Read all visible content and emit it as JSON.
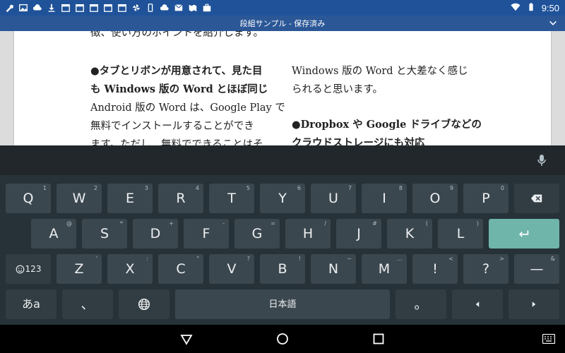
{
  "status_bar": {
    "time": "9:50",
    "icons": [
      "wrench-icon",
      "image-icon",
      "cloud-icon",
      "download-icon",
      "calendar-31-icon",
      "calendar-31-icon",
      "calendar-31-icon",
      "calendar-31-icon",
      "calendar-31-icon",
      "pinwheel-icon",
      "phone-icon",
      "cloud-icon",
      "mail-icon",
      "map-icon",
      "briefcase-icon"
    ]
  },
  "title_bar": {
    "title": "段組サンプル - 保存済み"
  },
  "document": {
    "top_line": "徴、使い方のポイントを紹介します。",
    "col1": [
      {
        "text": "●タブとリボンが用意されて、見た目",
        "bold": true
      },
      {
        "text": "も Windows 版の Word とほぼ同じ",
        "bold": true
      },
      {
        "text": "Android 版の Word は、Google Play で",
        "bold": false
      },
      {
        "text": "無料でインストールすることができ",
        "bold": false
      },
      {
        "text": "ます。ただし、無料でできることはそ",
        "bold": false
      }
    ],
    "col2_a": [
      {
        "text": "Windows 版の Word と大差なく感じ",
        "bold": false
      },
      {
        "text": "られると思います。",
        "bold": false
      }
    ],
    "col2_b": [
      {
        "text": "●Dropbox や Google ドライブなどの",
        "bold": true
      },
      {
        "text": "クラウドストレージにも対応",
        "bold": true
      }
    ]
  },
  "keyboard": {
    "row1": [
      {
        "label": "Q",
        "hint": "1"
      },
      {
        "label": "W",
        "hint": "2"
      },
      {
        "label": "E",
        "hint": "3"
      },
      {
        "label": "R",
        "hint": "4"
      },
      {
        "label": "T",
        "hint": "5"
      },
      {
        "label": "Y",
        "hint": "6"
      },
      {
        "label": "U",
        "hint": "7"
      },
      {
        "label": "I",
        "hint": "8"
      },
      {
        "label": "O",
        "hint": "9"
      },
      {
        "label": "P",
        "hint": "0"
      }
    ],
    "row2": [
      {
        "label": "A",
        "hint": "@"
      },
      {
        "label": "S",
        "hint": "*"
      },
      {
        "label": "D",
        "hint": "+"
      },
      {
        "label": "F",
        "hint": "-"
      },
      {
        "label": "G",
        "hint": "="
      },
      {
        "label": "H",
        "hint": "/"
      },
      {
        "label": "J",
        "hint": "#"
      },
      {
        "label": "K",
        "hint": "("
      },
      {
        "label": "L",
        "hint": ")"
      }
    ],
    "row3": [
      {
        "label": "Z",
        "hint": "'"
      },
      {
        "label": "X",
        "hint": ":"
      },
      {
        "label": "C",
        "hint": "\""
      },
      {
        "label": "V",
        "hint": "?"
      },
      {
        "label": "B",
        "hint": "!"
      },
      {
        "label": "N",
        "hint": "~"
      },
      {
        "label": "M",
        "hint": "…"
      },
      {
        "label": "!",
        "hint": "<"
      },
      {
        "label": "?",
        "hint": ">"
      }
    ],
    "symbols_key": "123",
    "dash_key": "—",
    "dash_hint": "&",
    "kana_key": "あa",
    "comma_key": "、",
    "space_key": "日本語",
    "period_key": "。",
    "enter_color": "#6fb5a9"
  }
}
